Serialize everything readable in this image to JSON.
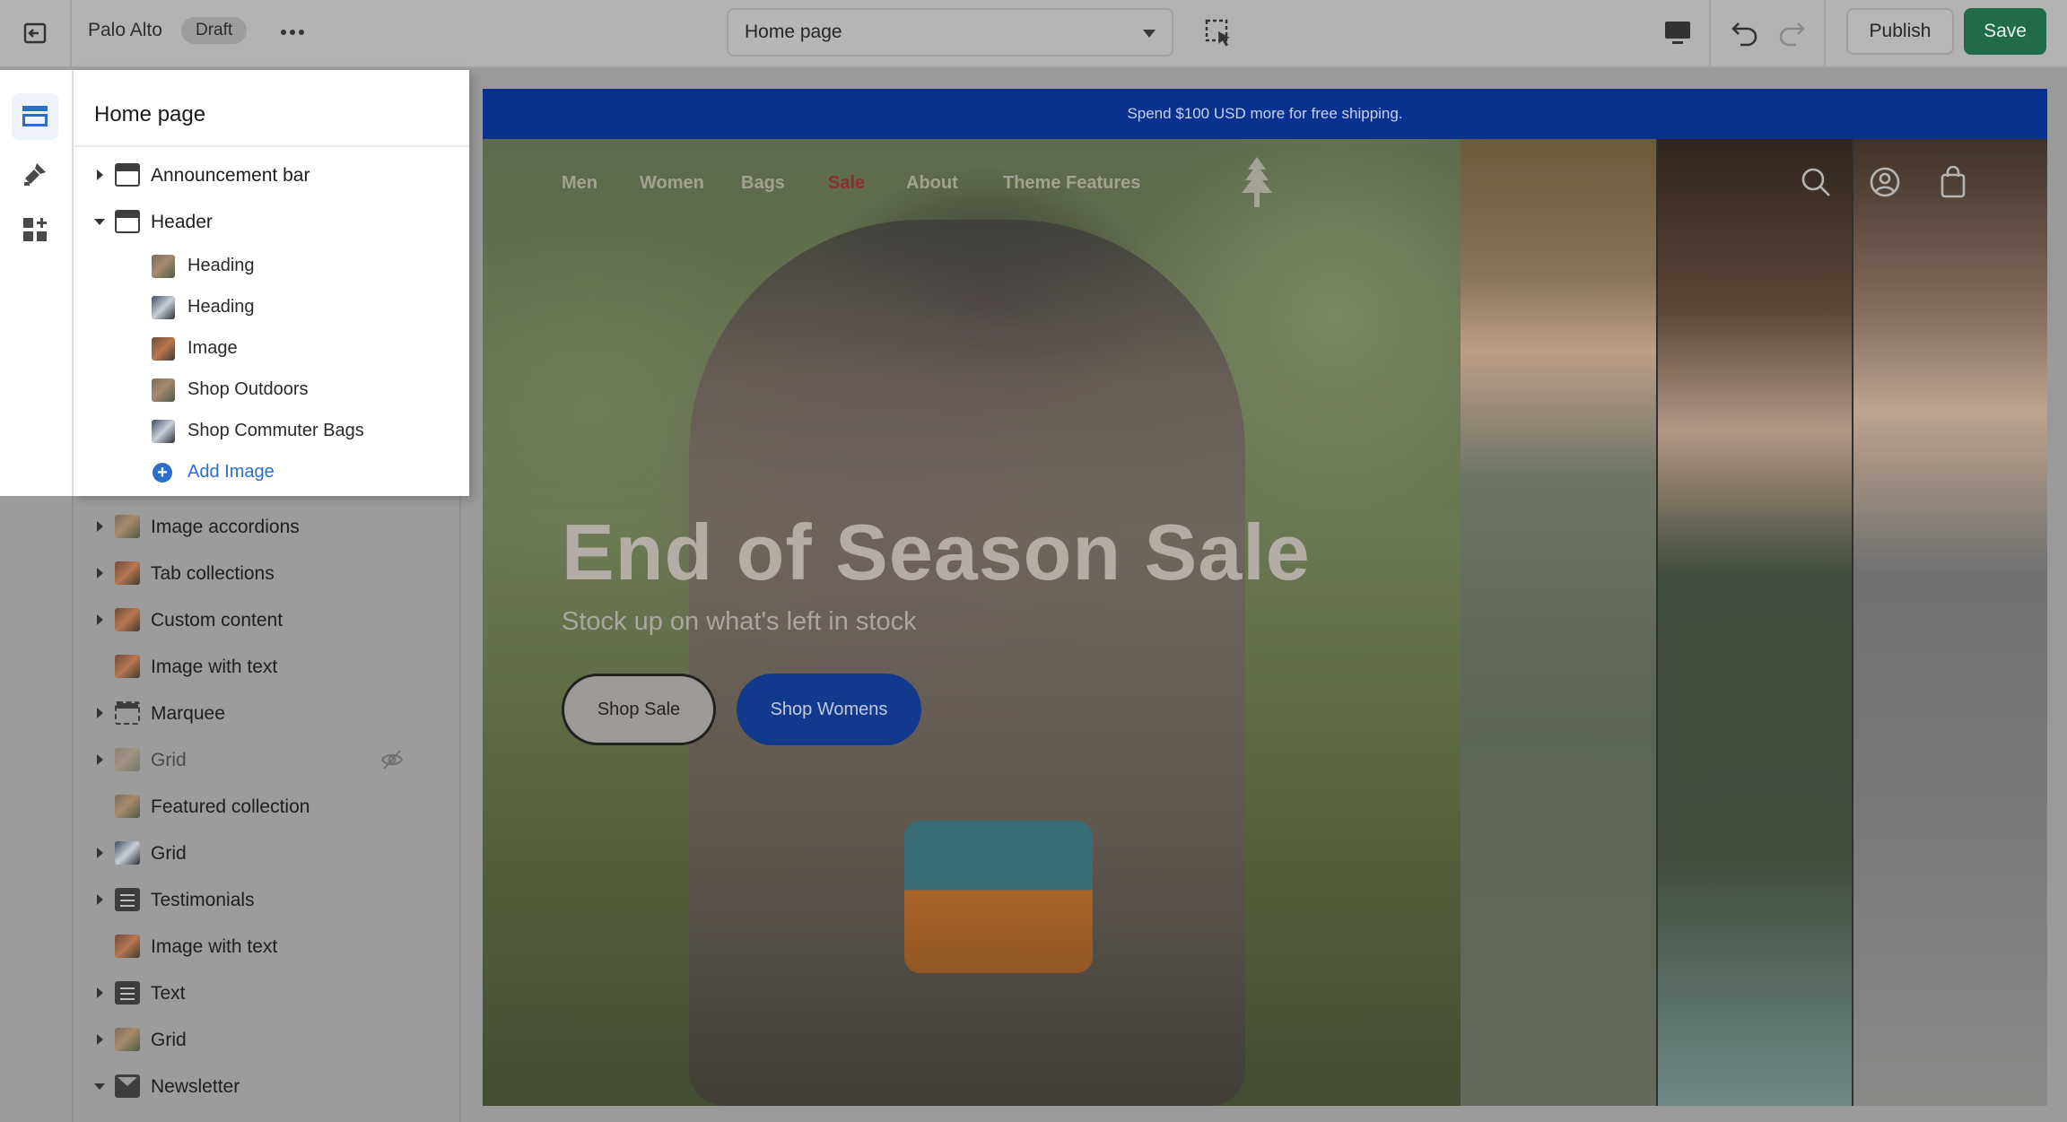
{
  "topbar": {
    "store_name": "Palo Alto",
    "status_badge": "Draft",
    "page_select": "Home page",
    "publish_label": "Publish",
    "save_label": "Save",
    "save_color": "#1f6b4a"
  },
  "rail": {
    "items": [
      {
        "icon": "sections-icon",
        "active": true
      },
      {
        "icon": "theme-settings-icon",
        "active": false
      },
      {
        "icon": "apps-icon",
        "active": false
      }
    ]
  },
  "sidebar": {
    "title": "Home page",
    "sections": [
      {
        "label": "Announcement bar",
        "icon": "section-icon",
        "expand": "collapsed"
      },
      {
        "label": "Header",
        "icon": "section-icon",
        "expand": "expanded"
      },
      {
        "label": "Heading",
        "icon": "image-thumb",
        "child": true
      },
      {
        "label": "Heading",
        "icon": "image-thumb",
        "child": true
      },
      {
        "label": "Image",
        "icon": "image-thumb",
        "child": true
      },
      {
        "label": "Shop Outdoors",
        "icon": "image-thumb",
        "child": true
      },
      {
        "label": "Shop Commuter Bags",
        "icon": "image-thumb",
        "child": true
      },
      {
        "label": "Add Image",
        "icon": "plus-circle-icon",
        "child": true,
        "add": true
      },
      {
        "label": "Image accordions",
        "icon": "image-thumb",
        "expand": "collapsed"
      },
      {
        "label": "Tab collections",
        "icon": "image-thumb",
        "expand": "collapsed"
      },
      {
        "label": "Custom content",
        "icon": "image-thumb",
        "expand": "collapsed"
      },
      {
        "label": "Image with text",
        "icon": "image-thumb",
        "expand": "none"
      },
      {
        "label": "Marquee",
        "icon": "marquee-icon",
        "expand": "collapsed"
      },
      {
        "label": "Grid",
        "icon": "image-thumb",
        "expand": "collapsed",
        "hidden": true
      },
      {
        "label": "Featured collection",
        "icon": "image-thumb",
        "expand": "none"
      },
      {
        "label": "Grid",
        "icon": "image-thumb",
        "expand": "collapsed"
      },
      {
        "label": "Testimonials",
        "icon": "text-icon",
        "expand": "collapsed"
      },
      {
        "label": "Image with text",
        "icon": "image-thumb",
        "expand": "none"
      },
      {
        "label": "Text",
        "icon": "text-icon",
        "expand": "collapsed"
      },
      {
        "label": "Grid",
        "icon": "image-thumb",
        "expand": "collapsed"
      },
      {
        "label": "Newsletter",
        "icon": "mail-icon",
        "expand": "expanded"
      }
    ]
  },
  "preview": {
    "announcement": "Spend $100 USD more for free shipping.",
    "nav": [
      "Men",
      "Women",
      "Bags",
      "Sale",
      "About",
      "Theme Features"
    ],
    "hero_title": "End of Season Sale",
    "hero_subtitle": "Stock up on what's left in stock",
    "button_primary": "Shop Sale",
    "button_secondary": "Shop Womens",
    "brand_blue": "#0a318f"
  }
}
